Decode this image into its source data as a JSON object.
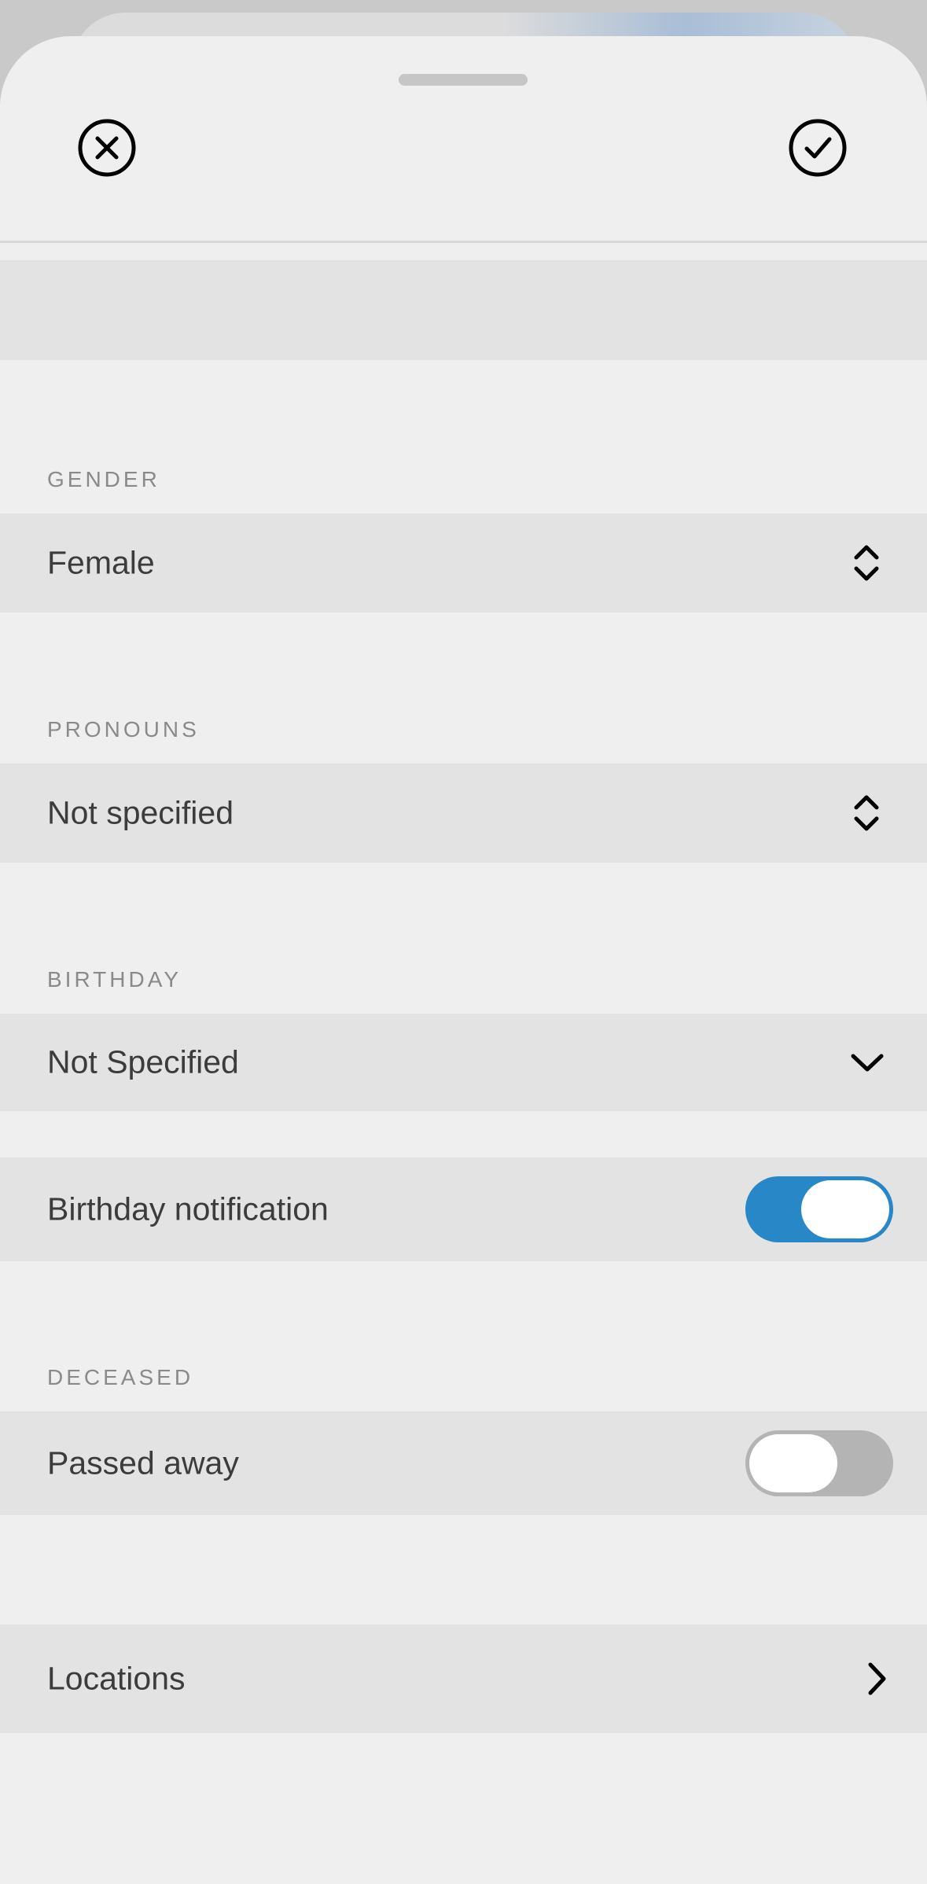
{
  "header": {
    "cancel_icon": "close-circle-icon",
    "confirm_icon": "check-circle-icon"
  },
  "gender": {
    "label": "GENDER",
    "value": "Female",
    "icon": "chevron-up-down-icon"
  },
  "pronouns": {
    "label": "PRONOUNS",
    "value": "Not specified",
    "icon": "chevron-up-down-icon"
  },
  "birthday": {
    "label": "BIRTHDAY",
    "value": "Not Specified",
    "icon": "chevron-down-icon",
    "notification_label": "Birthday notification",
    "notification_enabled": true
  },
  "deceased": {
    "label": "DECEASED",
    "passed_away_label": "Passed away",
    "passed_away_enabled": false
  },
  "locations": {
    "label": "Locations",
    "icon": "chevron-right-icon"
  },
  "colors": {
    "toggle_on": "#2887c6",
    "toggle_off": "#b4b4b4",
    "sheet_background": "#efefef",
    "row_background": "#e3e3e3"
  }
}
